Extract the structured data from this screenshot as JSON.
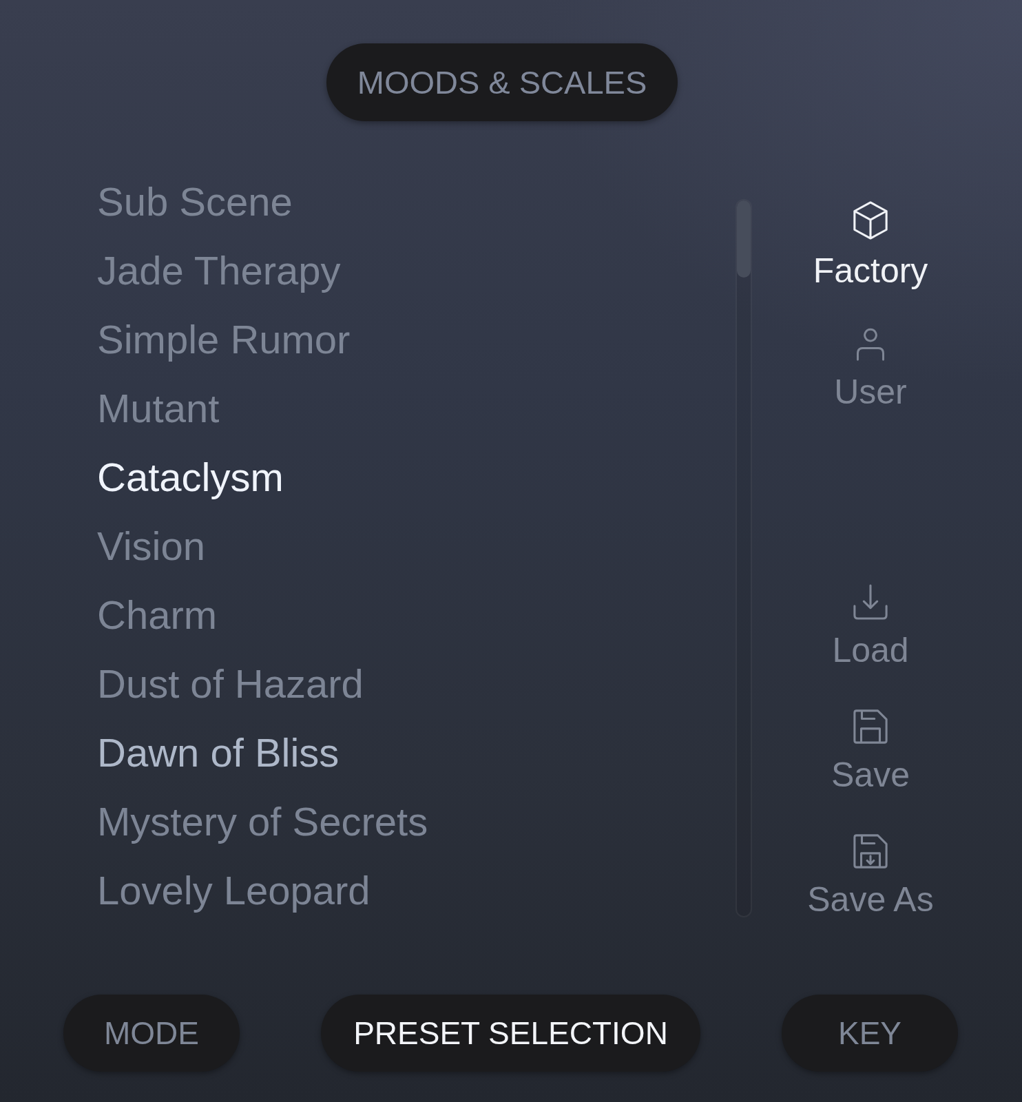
{
  "category_button": {
    "label": "MOODS & SCALES"
  },
  "presets": [
    {
      "name": "Sub Scene",
      "selected": false,
      "highlighted": false
    },
    {
      "name": "Jade Therapy",
      "selected": false,
      "highlighted": false
    },
    {
      "name": "Simple Rumor",
      "selected": false,
      "highlighted": false
    },
    {
      "name": "Mutant",
      "selected": false,
      "highlighted": false
    },
    {
      "name": "Cataclysm",
      "selected": true,
      "highlighted": false
    },
    {
      "name": "Vision",
      "selected": false,
      "highlighted": false
    },
    {
      "name": "Charm",
      "selected": false,
      "highlighted": false
    },
    {
      "name": "Dust of Hazard",
      "selected": false,
      "highlighted": false
    },
    {
      "name": "Dawn of Bliss",
      "selected": false,
      "highlighted": true
    },
    {
      "name": "Mystery of Secrets",
      "selected": false,
      "highlighted": false
    },
    {
      "name": "Lovely Leopard",
      "selected": false,
      "highlighted": false
    }
  ],
  "sources": [
    {
      "label": "Factory",
      "selected": true
    },
    {
      "label": "User",
      "selected": false
    }
  ],
  "actions": [
    {
      "label": "Load"
    },
    {
      "label": "Save"
    },
    {
      "label": "Save As"
    }
  ],
  "tabs": [
    {
      "label": "MODE",
      "selected": false
    },
    {
      "label": "PRESET SELECTION",
      "selected": true
    },
    {
      "label": "KEY",
      "selected": false
    }
  ]
}
